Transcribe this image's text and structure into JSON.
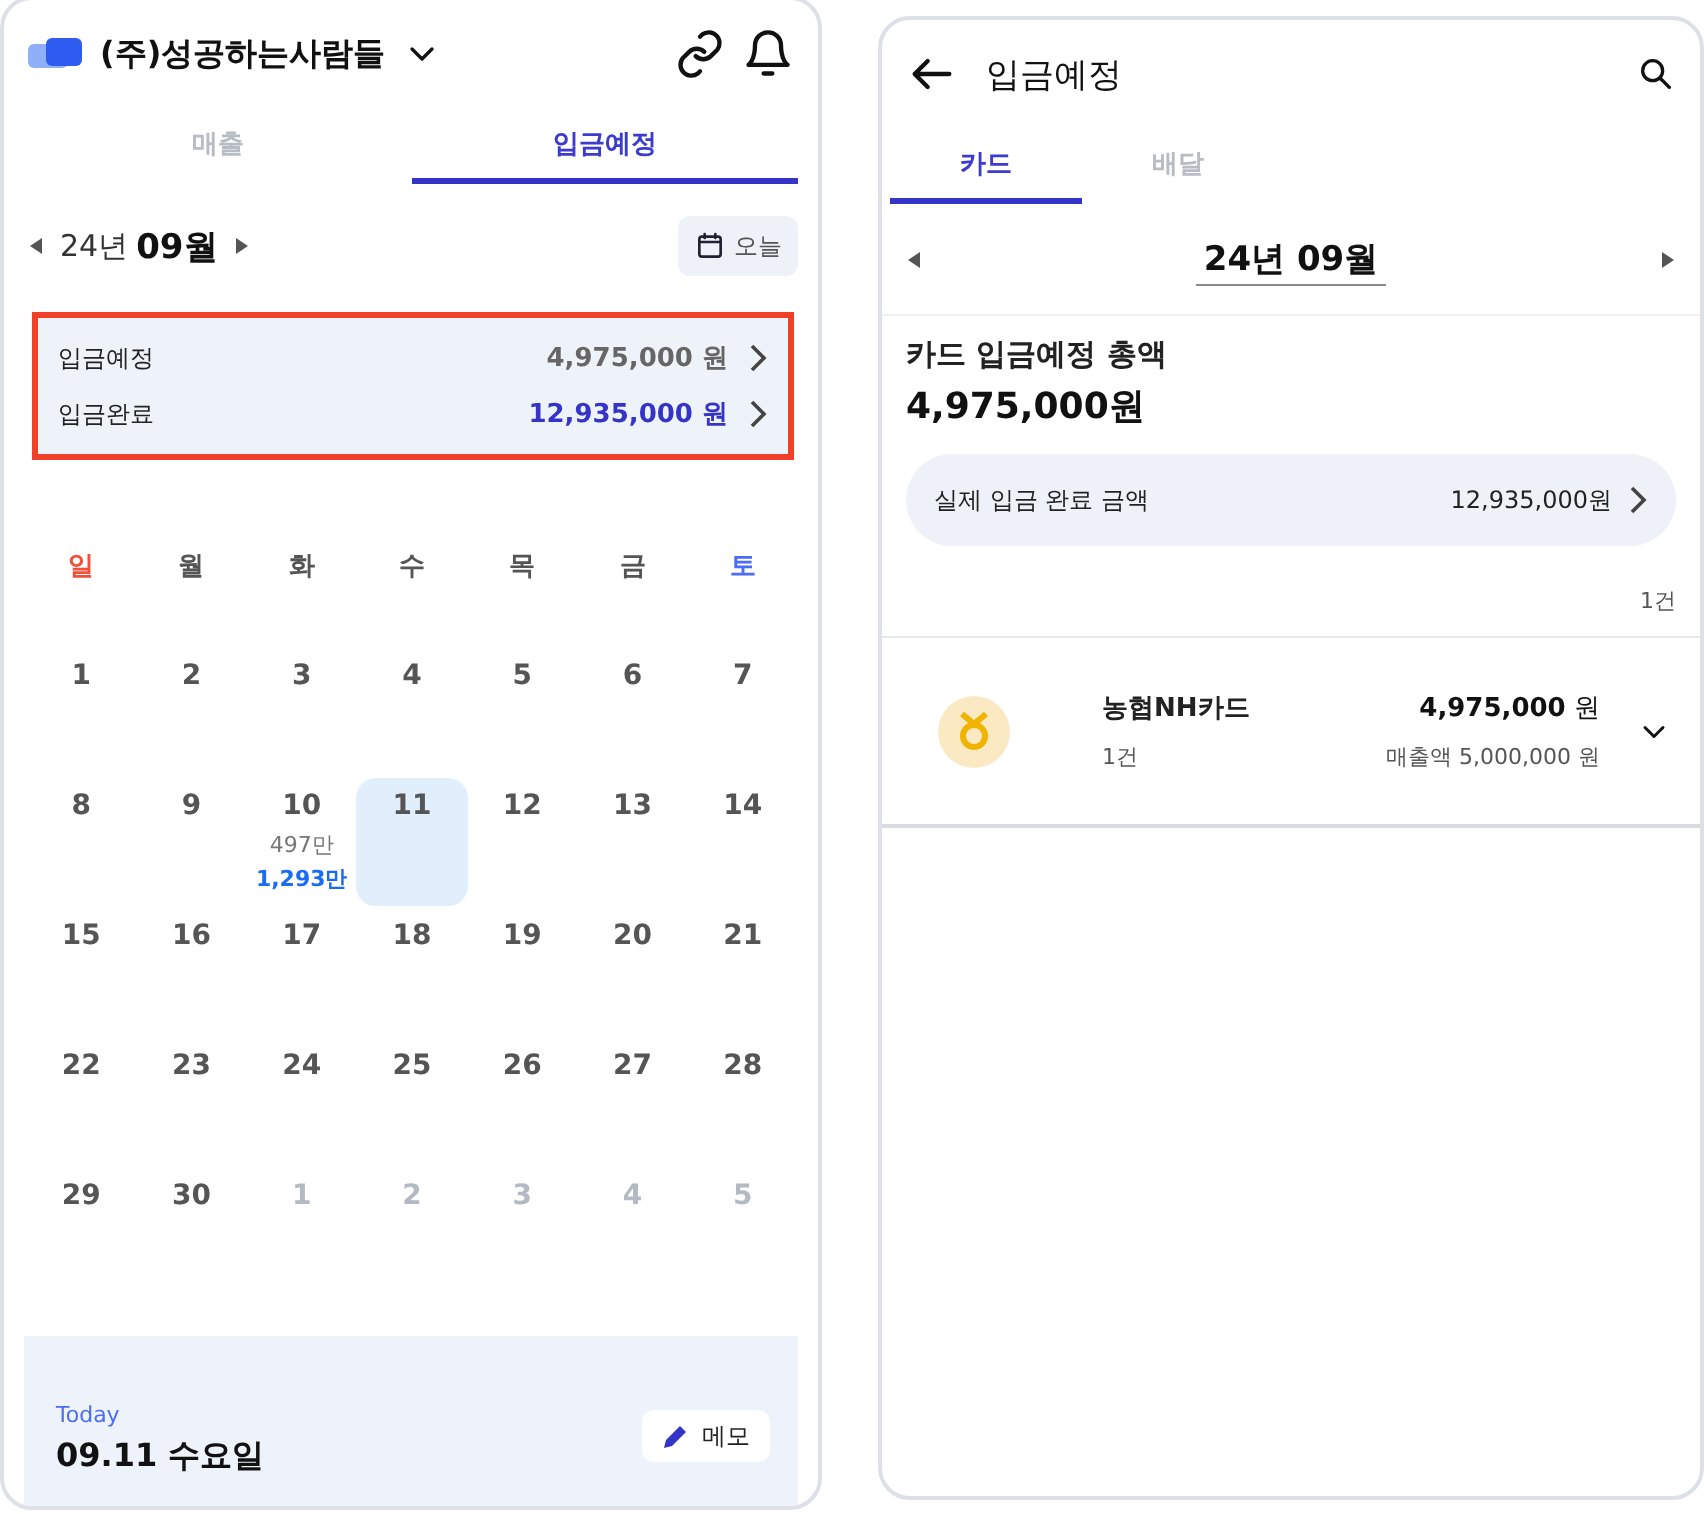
{
  "left": {
    "company": "(주)성공하는사람들",
    "tabs": [
      {
        "label": "매출",
        "selected": false
      },
      {
        "label": "입금예정",
        "selected": true
      }
    ],
    "month": {
      "year": "24년",
      "month": "09월",
      "today_button": "오늘"
    },
    "summary": {
      "highlighted": true,
      "rows": [
        {
          "label": "입금예정",
          "amount": "4,975,000 원",
          "kind": "expected"
        },
        {
          "label": "입금완료",
          "amount": "12,935,000 원",
          "kind": "done"
        }
      ]
    },
    "weekdays": [
      {
        "label": "일",
        "color": "#f0503c"
      },
      {
        "label": "월",
        "color": "#555555"
      },
      {
        "label": "화",
        "color": "#555555"
      },
      {
        "label": "수",
        "color": "#555555"
      },
      {
        "label": "목",
        "color": "#555555"
      },
      {
        "label": "금",
        "color": "#555555"
      },
      {
        "label": "토",
        "color": "#4a6cf7"
      }
    ],
    "weeks": [
      [
        {
          "day": "1",
          "muted": false,
          "selected": false
        },
        {
          "day": "2",
          "muted": false,
          "selected": false
        },
        {
          "day": "3",
          "muted": false,
          "selected": false
        },
        {
          "day": "4",
          "muted": false,
          "selected": false
        },
        {
          "day": "5",
          "muted": false,
          "selected": false
        },
        {
          "day": "6",
          "muted": false,
          "selected": false
        },
        {
          "day": "7",
          "muted": false,
          "selected": false
        }
      ],
      [
        {
          "day": "8",
          "muted": false,
          "selected": false
        },
        {
          "day": "9",
          "muted": false,
          "selected": false
        },
        {
          "day": "10",
          "muted": false,
          "selected": false,
          "expected": "497만",
          "done": "1,293만"
        },
        {
          "day": "11",
          "muted": false,
          "selected": true
        },
        {
          "day": "12",
          "muted": false,
          "selected": false
        },
        {
          "day": "13",
          "muted": false,
          "selected": false
        },
        {
          "day": "14",
          "muted": false,
          "selected": false
        }
      ],
      [
        {
          "day": "15",
          "muted": false,
          "selected": false
        },
        {
          "day": "16",
          "muted": false,
          "selected": false
        },
        {
          "day": "17",
          "muted": false,
          "selected": false
        },
        {
          "day": "18",
          "muted": false,
          "selected": false
        },
        {
          "day": "19",
          "muted": false,
          "selected": false
        },
        {
          "day": "20",
          "muted": false,
          "selected": false
        },
        {
          "day": "21",
          "muted": false,
          "selected": false
        }
      ],
      [
        {
          "day": "22",
          "muted": false,
          "selected": false
        },
        {
          "day": "23",
          "muted": false,
          "selected": false
        },
        {
          "day": "24",
          "muted": false,
          "selected": false
        },
        {
          "day": "25",
          "muted": false,
          "selected": false
        },
        {
          "day": "26",
          "muted": false,
          "selected": false
        },
        {
          "day": "27",
          "muted": false,
          "selected": false
        },
        {
          "day": "28",
          "muted": false,
          "selected": false
        }
      ],
      [
        {
          "day": "29",
          "muted": false,
          "selected": false
        },
        {
          "day": "30",
          "muted": false,
          "selected": false
        },
        {
          "day": "1",
          "muted": true,
          "selected": false
        },
        {
          "day": "2",
          "muted": true,
          "selected": false
        },
        {
          "day": "3",
          "muted": true,
          "selected": false
        },
        {
          "day": "4",
          "muted": true,
          "selected": false
        },
        {
          "day": "5",
          "muted": true,
          "selected": false
        }
      ]
    ],
    "today": {
      "caption": "Today",
      "date": "09.11 수요일",
      "memo_button": "메모"
    }
  },
  "right": {
    "title": "입금예정",
    "tabs": [
      {
        "label": "카드",
        "selected": true
      },
      {
        "label": "배달",
        "selected": false
      }
    ],
    "month": "24년 09월",
    "total_label": "카드 입금예정 총액",
    "total": "4,975,000원",
    "actual": {
      "label": "실제 입금 완료 금액",
      "amount": "12,935,000원"
    },
    "count": "1건",
    "cards": [
      {
        "name": "농협NH카드",
        "count": "1건",
        "amount": "4,975,000",
        "unit": "원",
        "sales": "매출액 5,000,000 원",
        "expanded": false
      }
    ]
  }
}
